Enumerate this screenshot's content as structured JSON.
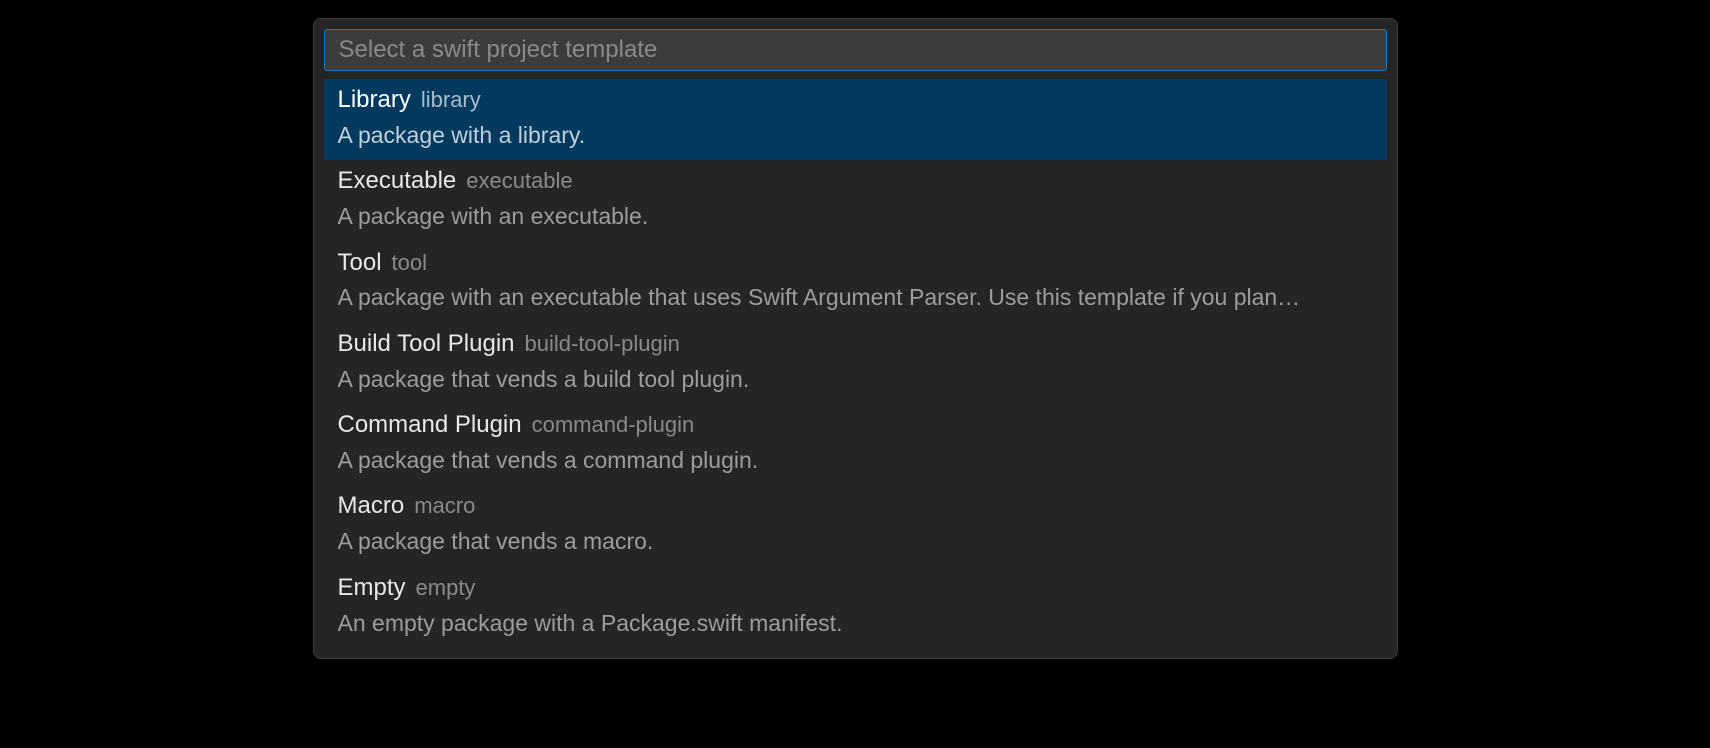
{
  "input": {
    "placeholder": "Select a swift project template",
    "value": ""
  },
  "items": [
    {
      "label": "Library",
      "id": "library",
      "description": "A package with a library.",
      "selected": true
    },
    {
      "label": "Executable",
      "id": "executable",
      "description": "A package with an executable.",
      "selected": false
    },
    {
      "label": "Tool",
      "id": "tool",
      "description": "A package with an executable that uses Swift Argument Parser. Use this template if you plan…",
      "selected": false
    },
    {
      "label": "Build Tool Plugin",
      "id": "build-tool-plugin",
      "description": "A package that vends a build tool plugin.",
      "selected": false
    },
    {
      "label": "Command Plugin",
      "id": "command-plugin",
      "description": "A package that vends a command plugin.",
      "selected": false
    },
    {
      "label": "Macro",
      "id": "macro",
      "description": "A package that vends a macro.",
      "selected": false
    },
    {
      "label": "Empty",
      "id": "empty",
      "description": "An empty package with a Package.swift manifest.",
      "selected": false
    }
  ]
}
